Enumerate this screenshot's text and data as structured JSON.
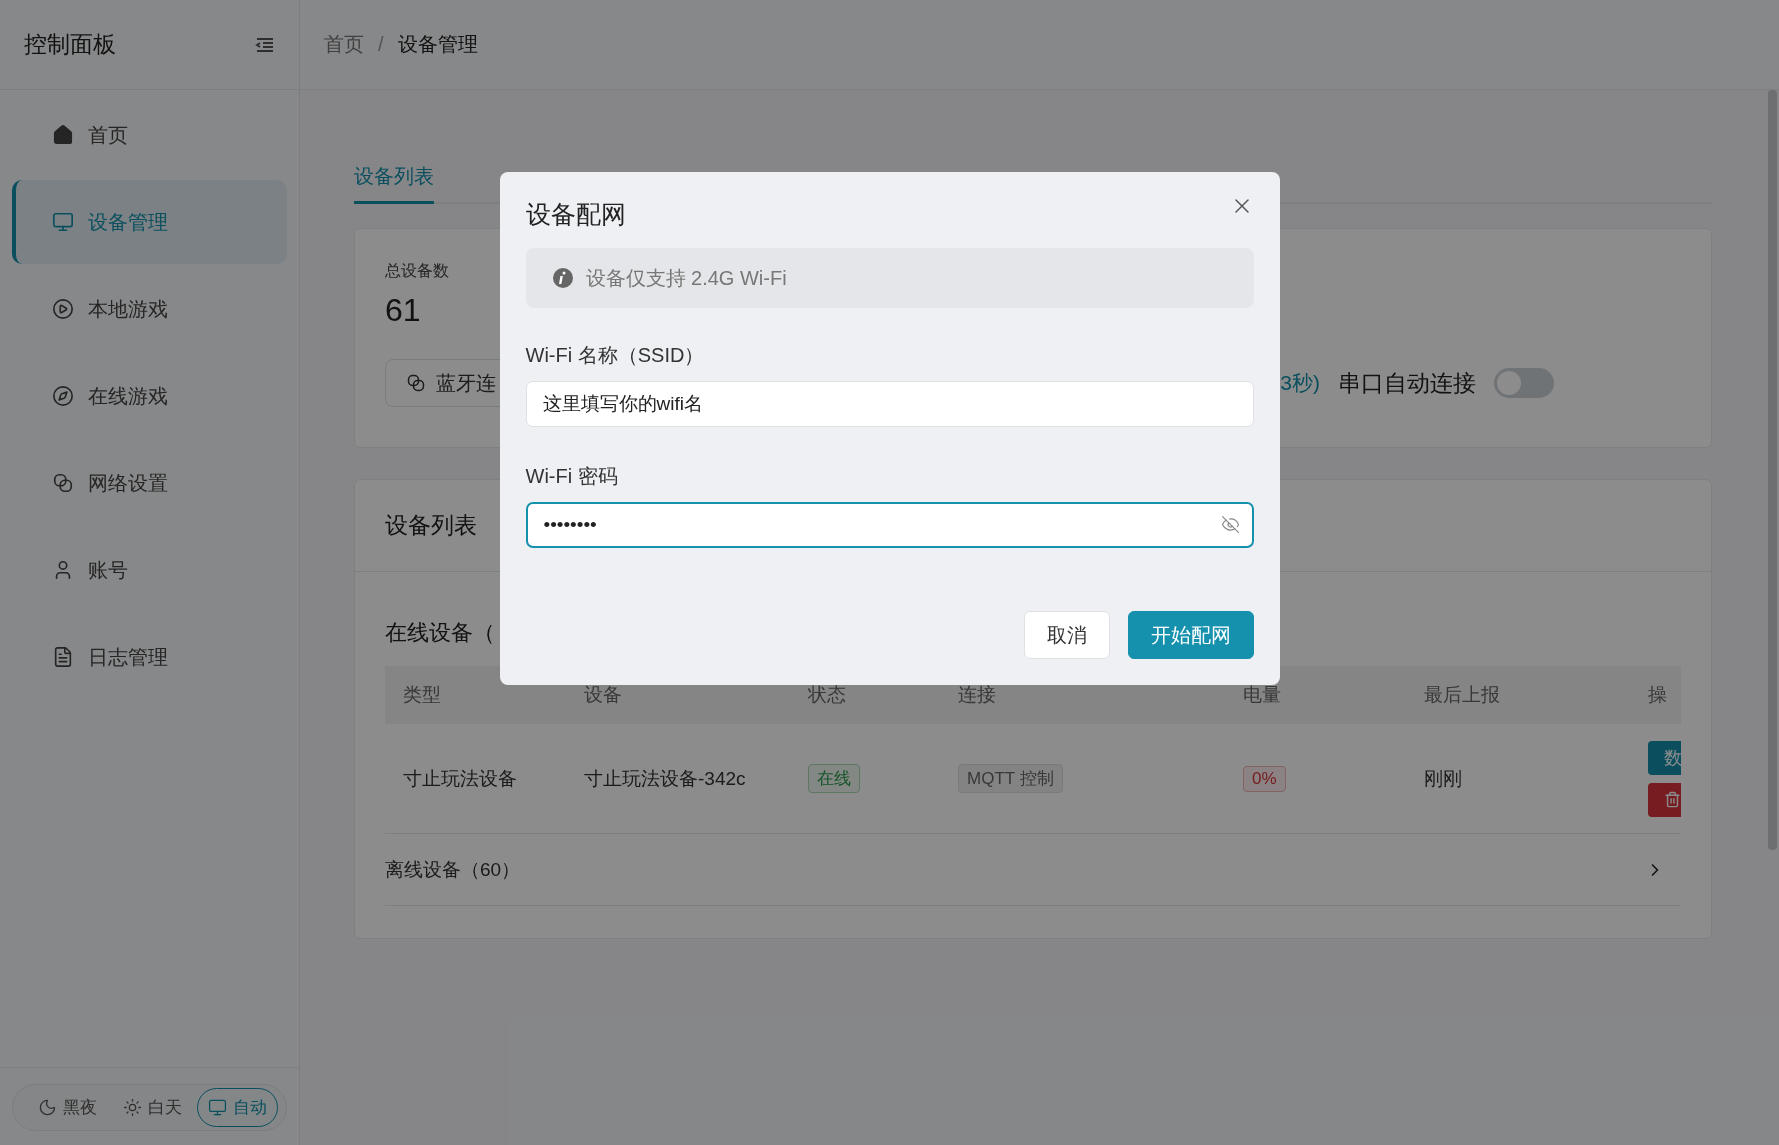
{
  "sidebar": {
    "title": "控制面板",
    "nav": [
      {
        "label": "首页",
        "selected": false
      },
      {
        "label": "设备管理",
        "selected": true
      },
      {
        "label": "本地游戏",
        "selected": false
      },
      {
        "label": "在线游戏",
        "selected": false
      },
      {
        "label": "网络设置",
        "selected": false
      },
      {
        "label": "账号",
        "selected": false
      },
      {
        "label": "日志管理",
        "selected": false
      }
    ],
    "theme_switch": [
      {
        "label": "黑夜",
        "selected": false
      },
      {
        "label": "白天",
        "selected": false
      },
      {
        "label": "自动",
        "selected": true
      }
    ]
  },
  "breadcrumb": {
    "separator": "/",
    "items": [
      "首页",
      "设备管理"
    ]
  },
  "tabs": [
    {
      "label": "设备列表",
      "selected": true
    }
  ],
  "stats": {
    "label": "总设备数",
    "value": "61",
    "bluetooth_button": "蓝牙连",
    "countdown": "3秒)",
    "serial_auto_connect": {
      "label": "串口自动连接",
      "on": false
    }
  },
  "device_list": {
    "title": "设备列表",
    "online_section": {
      "title": "在线设备（",
      "columns": [
        "类型",
        "设备",
        "状态",
        "连接",
        "电量",
        "最后上报",
        "操"
      ],
      "rows": [
        {
          "type": "寸止玩法设备",
          "device": "寸止玩法设备-342c",
          "status": "在线",
          "connection": "MQTT 控制",
          "battery": "0%",
          "last_report": "刚刚",
          "actions": [
            {
              "kind": "data",
              "label": "数"
            },
            {
              "kind": "delete"
            }
          ]
        }
      ]
    },
    "offline_section": {
      "title": "离线设备（60）",
      "expanded": false
    }
  },
  "dialog": {
    "title": "设备配网",
    "notice": "设备仅支持 2.4G Wi-Fi",
    "ssid": {
      "label": "Wi-Fi 名称（SSID）",
      "value": "这里填写你的wifi名"
    },
    "password": {
      "label": "Wi-Fi 密码",
      "value": "••••••••",
      "focused": true
    },
    "buttons": [
      {
        "kind": "cancel",
        "label": "取消"
      },
      {
        "kind": "primary",
        "label": "开始配网"
      }
    ]
  }
}
